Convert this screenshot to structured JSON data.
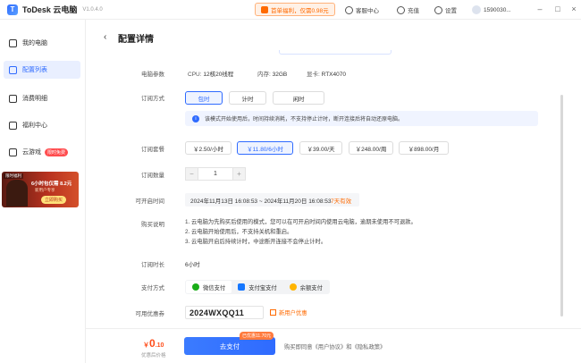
{
  "titlebar": {
    "app_name": "ToDesk 云电脑",
    "version": "V1.0.4.0",
    "promo": "首单福利，仅需0.98元",
    "support": "客服中心",
    "recharge": "充值",
    "settings": "设置",
    "user": "1590030..."
  },
  "sidebar": {
    "items": [
      {
        "label": "我的电脑"
      },
      {
        "label": "配置列表"
      },
      {
        "label": "消费明细"
      },
      {
        "label": "福利中心"
      },
      {
        "label": "云游戏",
        "badge": "限时免费"
      }
    ],
    "ad": {
      "tag": "限时福利",
      "title": "6小时包仅需 8.2元",
      "sub": "新用户专享",
      "button": "立即购买"
    }
  },
  "page": {
    "title": "配置详情",
    "labels": {
      "specs": "电脑参数",
      "sub_mode": "订阅方式",
      "package": "订阅套餐",
      "quantity": "订阅数量",
      "open_time": "可开启时间",
      "notes": "购买说明",
      "duration": "订阅时长",
      "payment": "支付方式",
      "coupon": "可用优惠券"
    },
    "specs": {
      "cpu_label": "CPU:",
      "cpu_value": "12核20线程",
      "mem_label": "内存:",
      "mem_value": "32GB",
      "gpu_label": "显卡:",
      "gpu_value": "RTX4070"
    },
    "modes": [
      "包时",
      "计时",
      "闲时"
    ],
    "mode_info": "该模式开始使用后，时间持续消耗，不支持停止计时，断开连接后将自动还原电脑。",
    "packages": [
      "￥2.50/小时",
      "￥11.80/6小时",
      "￥39.00/天",
      "￥248.00/周",
      "￥898.00/月"
    ],
    "quantity": "1",
    "open_range": "2024年11月13日 16:08:53 ~ 2024年11月20日 16:08:53",
    "valid_days": "7天有效",
    "notes": [
      "1. 云电脑为先购买后使用的模式，您可以在可开启时间内使用云电脑，逾期未使用不可退款。",
      "2. 云电脑开始使用后，不支持关机和重启。",
      "3. 云电脑开启后持续计时，中途断开连接不会停止计时。"
    ],
    "duration": "6小时",
    "payments": [
      "微信支付",
      "支付宝支付",
      "余额支付"
    ],
    "coupon_code": "2024WXQQ11",
    "coupon_tag": "新用户优惠"
  },
  "bottom": {
    "price_symbol": "￥",
    "price_int": "0",
    "price_dec": ".10",
    "price_sub": "优惠后价格",
    "discount_tag": "已优惠11.70元",
    "pay_button": "去支付",
    "agreement": "购买即同意《用户协议》和《隐私政策》"
  },
  "colors": {
    "accent": "#2f6bff",
    "orange": "#ff6a00",
    "price": "#ff4d1a"
  }
}
